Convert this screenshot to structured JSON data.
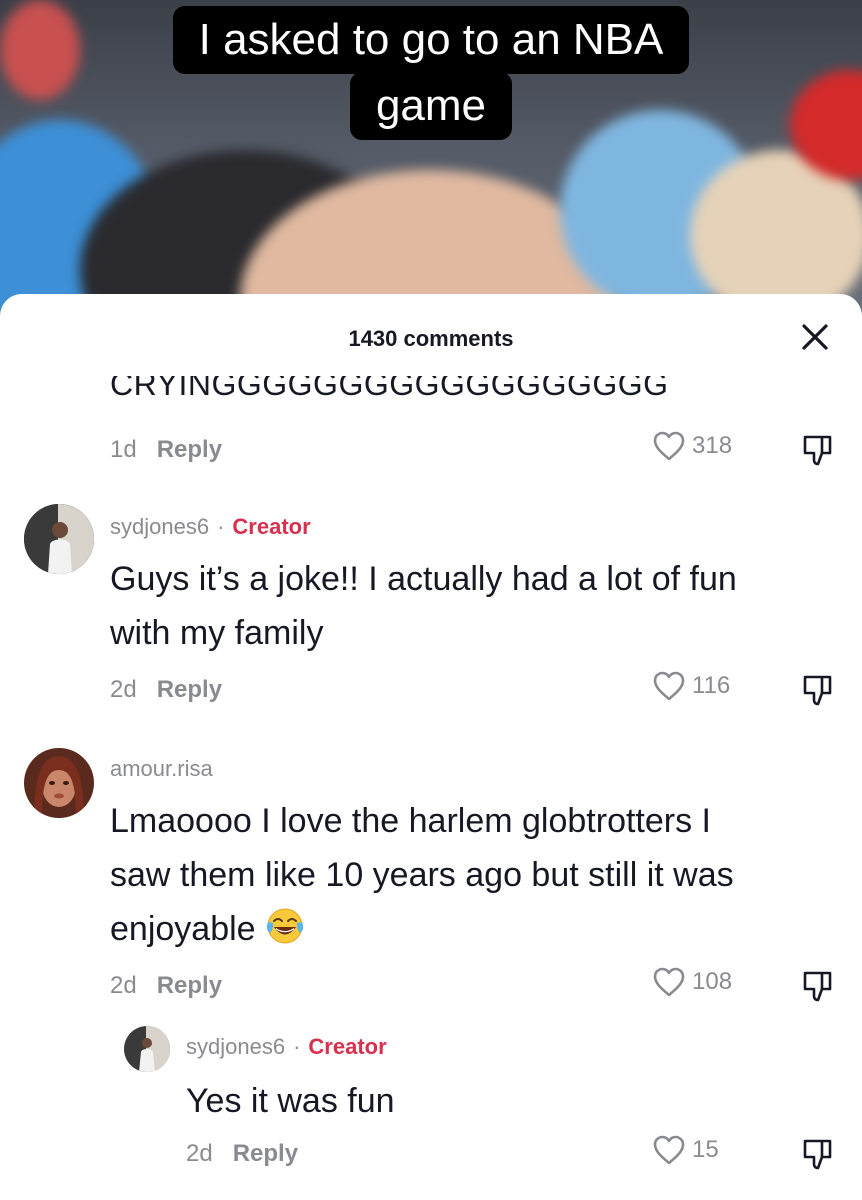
{
  "video": {
    "caption_line1": "I asked to go to an NBA",
    "caption_line2": "game"
  },
  "sheet": {
    "comment_count": "1430 comments",
    "close_icon": "close-icon"
  },
  "comments": [
    {
      "text": "CRYINGGGGGGGGGGGGGGGGGG",
      "time": "1d",
      "reply_label": "Reply",
      "likes": "318",
      "truncated_top": true
    },
    {
      "username": "sydjones6",
      "separator": "·",
      "badge": "Creator",
      "line1": "Guys it’s a joke!! I actually had a lot of fun",
      "line2": "with my family",
      "time": "2d",
      "reply_label": "Reply",
      "likes": "116"
    },
    {
      "username": "amour.risa",
      "line1": "Lmaoooo I love the harlem globtrotters I",
      "line2": "saw them like 10 years ago but still it was",
      "line3": "enjoyable",
      "emoji": "face-with-tears-of-joy",
      "time": "2d",
      "reply_label": "Reply",
      "likes": "108"
    },
    {
      "username": "sydjones6",
      "separator": "·",
      "badge": "Creator",
      "line1": "Yes it was fun",
      "time": "2d",
      "reply_label": "Reply",
      "likes": "15",
      "is_reply": true
    }
  ],
  "colors": {
    "creator_badge": "#d8304f",
    "secondary_text": "#8a8b91",
    "primary_text": "#161823"
  }
}
